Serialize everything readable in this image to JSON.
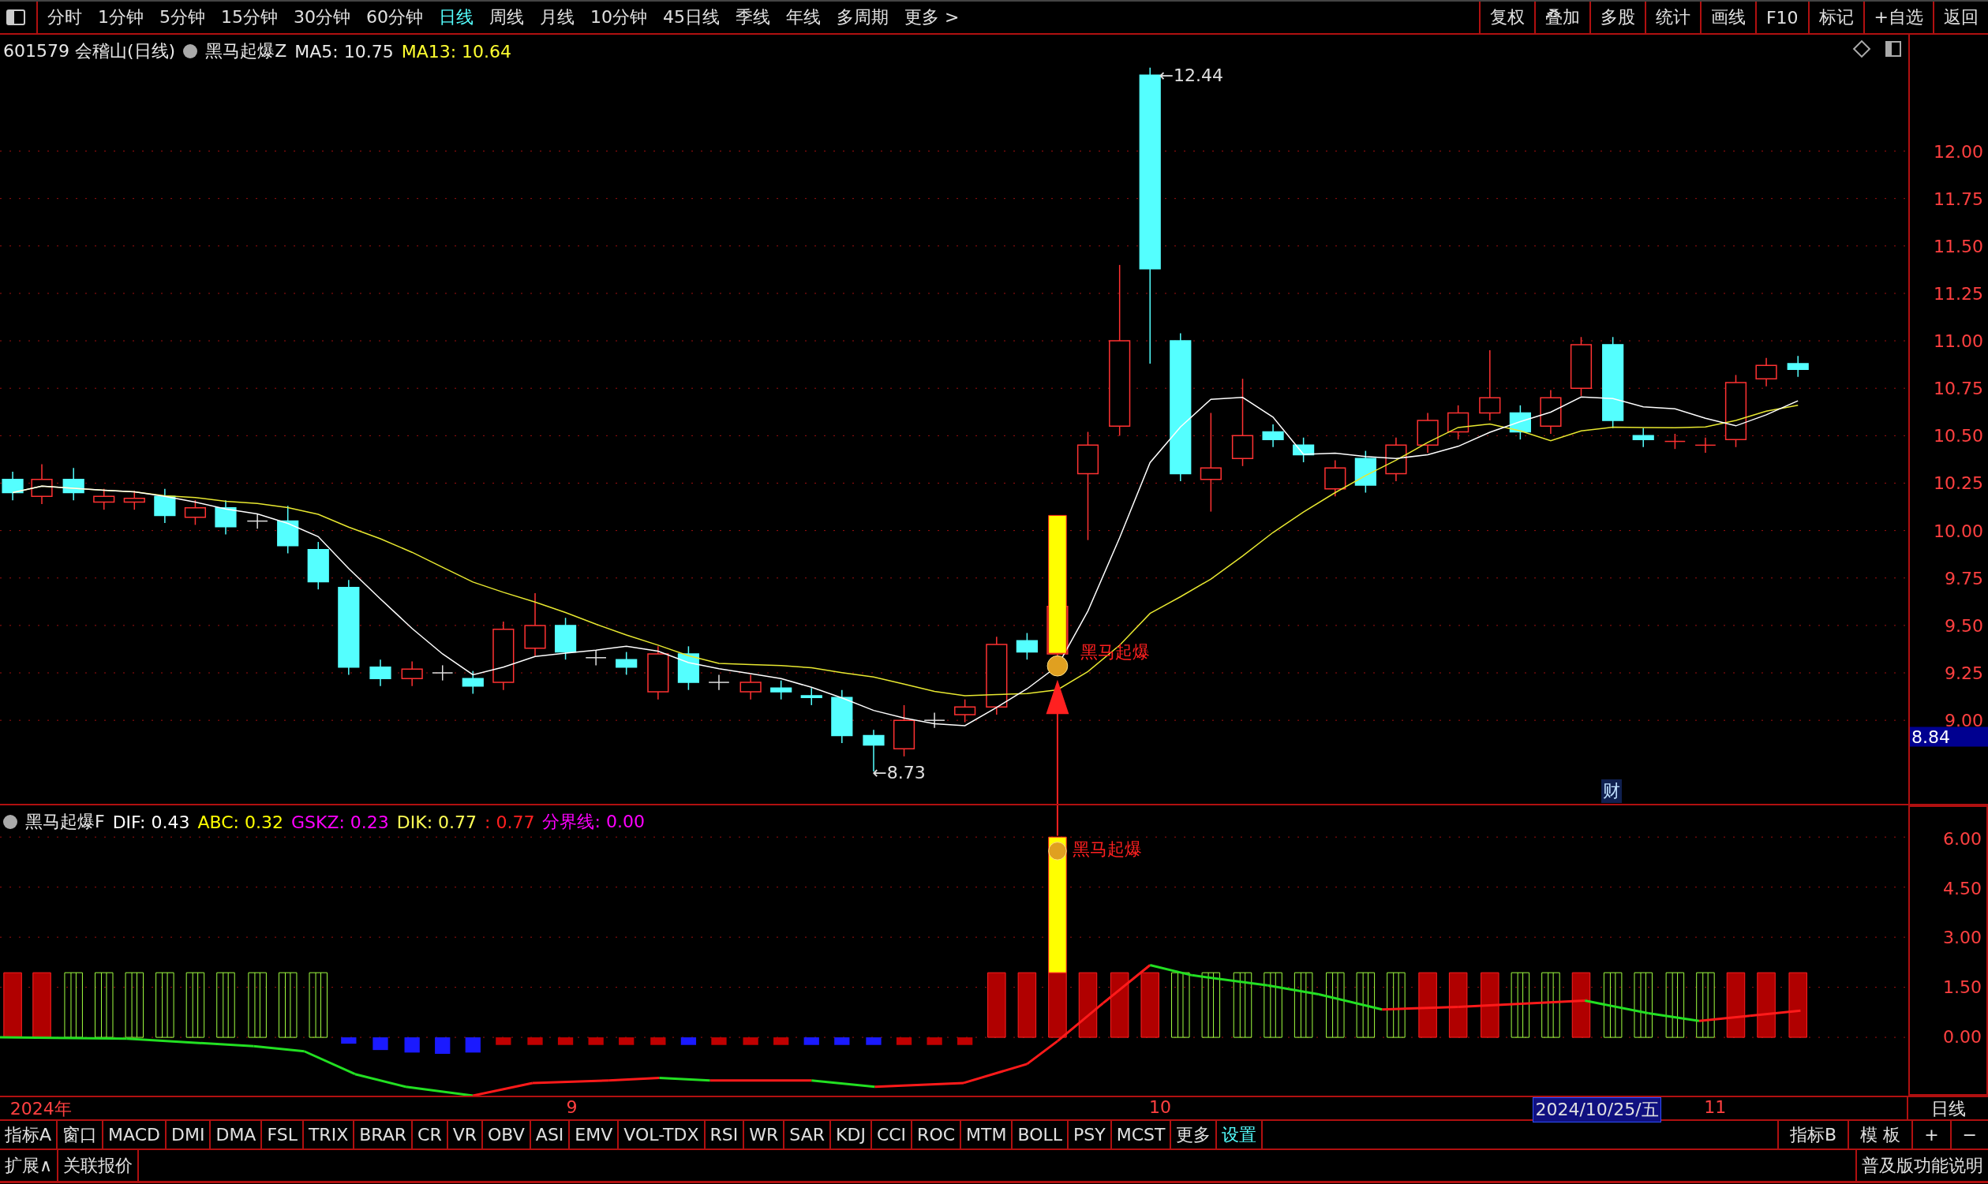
{
  "toolbar": {
    "periods": [
      {
        "label": "分时",
        "selected": false
      },
      {
        "label": "1分钟",
        "selected": false
      },
      {
        "label": "5分钟",
        "selected": false
      },
      {
        "label": "15分钟",
        "selected": false
      },
      {
        "label": "30分钟",
        "selected": false
      },
      {
        "label": "60分钟",
        "selected": false
      },
      {
        "label": "日线",
        "selected": true
      },
      {
        "label": "周线",
        "selected": false
      },
      {
        "label": "月线",
        "selected": false
      },
      {
        "label": "10分钟",
        "selected": false
      },
      {
        "label": "45日线",
        "selected": false
      },
      {
        "label": "季线",
        "selected": false
      },
      {
        "label": "年线",
        "selected": false
      },
      {
        "label": "多周期",
        "selected": false
      },
      {
        "label": "更多 >",
        "selected": false
      }
    ],
    "actions": [
      "复权",
      "叠加",
      "多股",
      "统计",
      "画线",
      "F10",
      "标记",
      "+自选",
      "返回"
    ]
  },
  "main_chart": {
    "title": "601579 会稽山(日线)",
    "indicator": "黑马起爆Z",
    "ma5": "MA5: 10.75",
    "ma13": "MA13: 10.64",
    "high_label": "←12.44",
    "low_label": "←8.73",
    "signal_label": "黑马起爆",
    "cai": "财",
    "y_labels": [
      "12.00",
      "11.75",
      "11.50",
      "11.25",
      "11.00",
      "10.75",
      "10.50",
      "10.25",
      "10.00",
      "9.75",
      "9.50",
      "9.25",
      "9.00"
    ],
    "price_tag": "8.84"
  },
  "sub_chart": {
    "indicator": "黑马起爆F",
    "values": [
      {
        "text": "DIF: 0.43",
        "color": "#ffffff"
      },
      {
        "text": "ABC: 0.32",
        "color": "#ffff00"
      },
      {
        "text": "GSKZ: 0.23",
        "color": "#ff00ff"
      },
      {
        "text": "DIK: 0.77",
        "color": "#ffff55"
      },
      {
        "text": ": 0.77",
        "color": "#ff2020"
      },
      {
        "text": "分界线: 0.00",
        "color": "#ff00ff"
      }
    ],
    "signal_label": "黑马起爆",
    "y_labels": [
      "6.00",
      "4.50",
      "3.00",
      "1.50",
      "0.00"
    ]
  },
  "date_axis": {
    "labels": [
      "2024年",
      "9",
      "10",
      "11"
    ],
    "cursor_date": "2024/10/25/五",
    "period": "日线"
  },
  "indicator_tabs": {
    "items": [
      {
        "label": "指标A",
        "selected": false
      },
      {
        "label": "窗口",
        "selected": false
      },
      {
        "label": "MACD",
        "selected": false
      },
      {
        "label": "DMI",
        "selected": false
      },
      {
        "label": "DMA",
        "selected": false
      },
      {
        "label": "FSL",
        "selected": false
      },
      {
        "label": "TRIX",
        "selected": false
      },
      {
        "label": "BRAR",
        "selected": false
      },
      {
        "label": "CR",
        "selected": false
      },
      {
        "label": "VR",
        "selected": false
      },
      {
        "label": "OBV",
        "selected": false
      },
      {
        "label": "ASI",
        "selected": false
      },
      {
        "label": "EMV",
        "selected": false
      },
      {
        "label": "VOL-TDX",
        "selected": false
      },
      {
        "label": "RSI",
        "selected": false
      },
      {
        "label": "WR",
        "selected": false
      },
      {
        "label": "SAR",
        "selected": false
      },
      {
        "label": "KDJ",
        "selected": false
      },
      {
        "label": "CCI",
        "selected": false
      },
      {
        "label": "ROC",
        "selected": false
      },
      {
        "label": "MTM",
        "selected": false
      },
      {
        "label": "BOLL",
        "selected": false
      },
      {
        "label": "PSY",
        "selected": false
      },
      {
        "label": "MCST",
        "selected": false
      },
      {
        "label": "更多",
        "selected": false
      },
      {
        "label": "设置",
        "selected": true
      }
    ],
    "right": [
      "指标B",
      "模 板",
      "+",
      "−"
    ]
  },
  "status_bar": {
    "left": [
      "扩展∧",
      "关联报价"
    ],
    "right": "普及版功能说明"
  }
}
